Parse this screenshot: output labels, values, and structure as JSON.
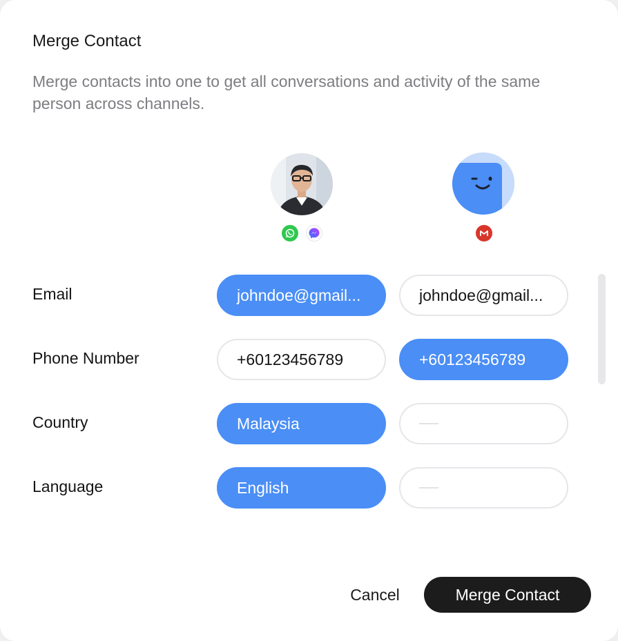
{
  "dialog": {
    "title": "Merge Contact",
    "description": "Merge contacts into one to get all conversations and activity of the same person across channels."
  },
  "contacts": [
    {
      "avatar": "person-photo",
      "channels": [
        "whatsapp-icon",
        "messenger-icon"
      ]
    },
    {
      "avatar": "smiley-placeholder",
      "channels": [
        "gmail-icon"
      ]
    }
  ],
  "fields": {
    "email": {
      "label": "Email",
      "a": "johndoe@gmail...",
      "b": "johndoe@gmail..."
    },
    "phone": {
      "label": "Phone Number",
      "a": "+60123456789",
      "b": "+60123456789"
    },
    "country": {
      "label": "Country",
      "a": "Malaysia",
      "b": ""
    },
    "language": {
      "label": "Language",
      "a": "English",
      "b": ""
    }
  },
  "footer": {
    "cancel_label": "Cancel",
    "merge_label": "Merge Contact"
  },
  "colors": {
    "selected": "#4a8ef6",
    "primary_button": "#1c1c1c",
    "whatsapp": "#2fc84f",
    "gmail": "#d9362b"
  }
}
